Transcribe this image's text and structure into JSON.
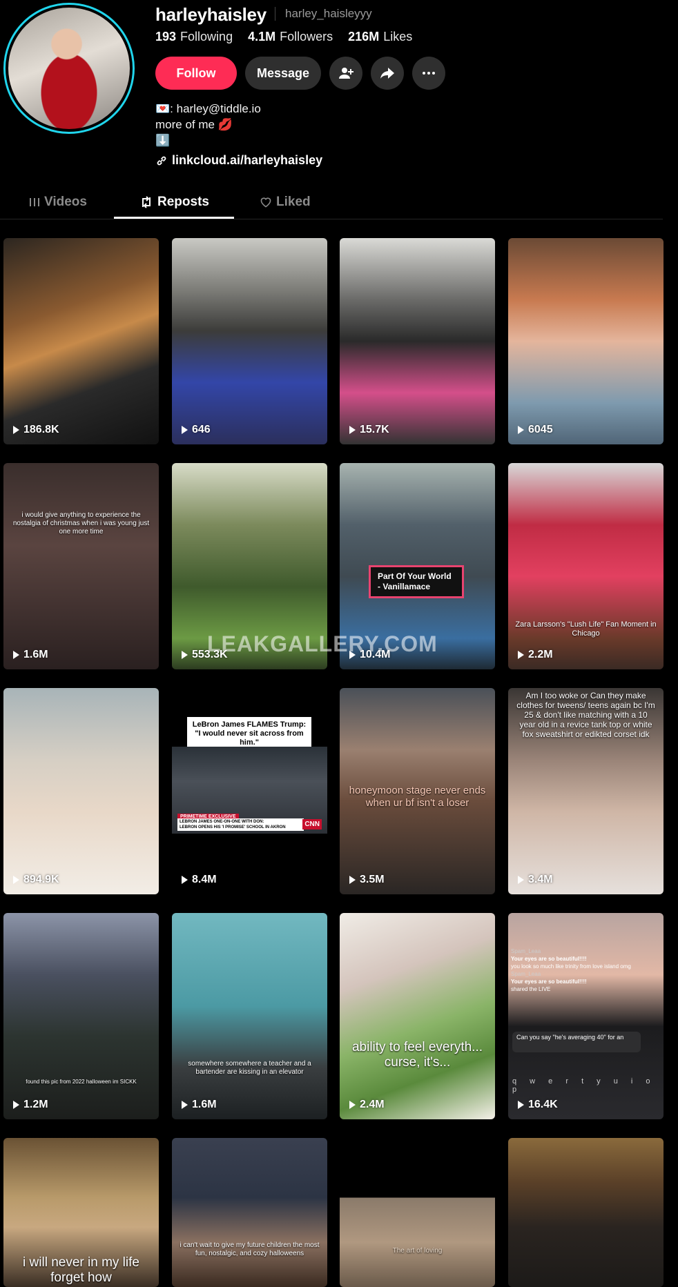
{
  "profile": {
    "username": "harleyhaisley",
    "handle": "harley_haisleyyy",
    "following_count": "193",
    "following_label": "Following",
    "followers_count": "4.1M",
    "followers_label": "Followers",
    "likes_count": "216M",
    "likes_label": "Likes",
    "follow_label": "Follow",
    "message_label": "Message",
    "bio_line1": "💌: harley@tiddle.io",
    "bio_line2": "more of me 💋",
    "bio_line3": "⬇️",
    "link": "linkcloud.ai/harleyhaisley"
  },
  "tabs": [
    {
      "label": "Videos"
    },
    {
      "label": "Reposts"
    },
    {
      "label": "Liked"
    }
  ],
  "watermark": "LEAKGALLERY.COM",
  "videos": [
    {
      "views": "186.8K",
      "caption": ""
    },
    {
      "views": "646",
      "caption": ""
    },
    {
      "views": "15.7K",
      "caption": ""
    },
    {
      "views": "6045",
      "caption": ""
    },
    {
      "views": "1.6M",
      "caption": "i would give anything to experience the nostalgia of christmas when i was young just one more time"
    },
    {
      "views": "553.3K",
      "caption": ""
    },
    {
      "views": "10.4M",
      "caption": "Part Of Your World - Vanillamace"
    },
    {
      "views": "2.2M",
      "caption": "Zara Larsson's \"Lush Life\" Fan Moment in Chicago"
    },
    {
      "views": "894.9K",
      "caption": ""
    },
    {
      "views": "8.4M",
      "caption": "LeBron James FLAMES Trump: \"I would never sit across from him.\""
    },
    {
      "views": "3.5M",
      "caption": "honeymoon stage never ends when ur bf isn't a loser"
    },
    {
      "views": "3.4M",
      "caption": "Am I too woke or Can they make clothes for tweens/ teens again bc I'm 25 & don't like matching with a 10 year old in a revice tank top or white fox sweatshirt or edikted corset idk"
    },
    {
      "views": "1.2M",
      "caption": "found this pic from 2022 halloween im SICKK"
    },
    {
      "views": "1.6M",
      "caption": "somewhere somewhere a teacher and a bartender are kissing in an elevator"
    },
    {
      "views": "2.4M",
      "caption": "ability to feel everyth... curse, it's..."
    },
    {
      "views": "16.4K",
      "caption": "Can you say \"he's averaging 40\" for an"
    },
    {
      "views": "",
      "caption": "i will never in my life forget how"
    },
    {
      "views": "",
      "caption": "i can't wait to give my future children the most fun, nostalgic, and cozy halloweens"
    },
    {
      "views": "",
      "caption": "The art of loving"
    },
    {
      "views": "",
      "caption": ""
    }
  ],
  "news": {
    "banner": "PRIMETIME EXCLUSIVE",
    "line1": "LEBRON JAMES ONE-ON-ONE WITH DON:",
    "line2": "LEBRON OPENS HIS 'I PROMISE' SCHOOL IN AKRON"
  },
  "chat": {
    "user": "Spam_Leaa",
    "msg1": "Your eyes are so beautiful!!!!",
    "msg2": "you look so much like trinity from love island omg",
    "msg3": "shared the LIVE",
    "keys": "q w e r t y u i o p"
  }
}
